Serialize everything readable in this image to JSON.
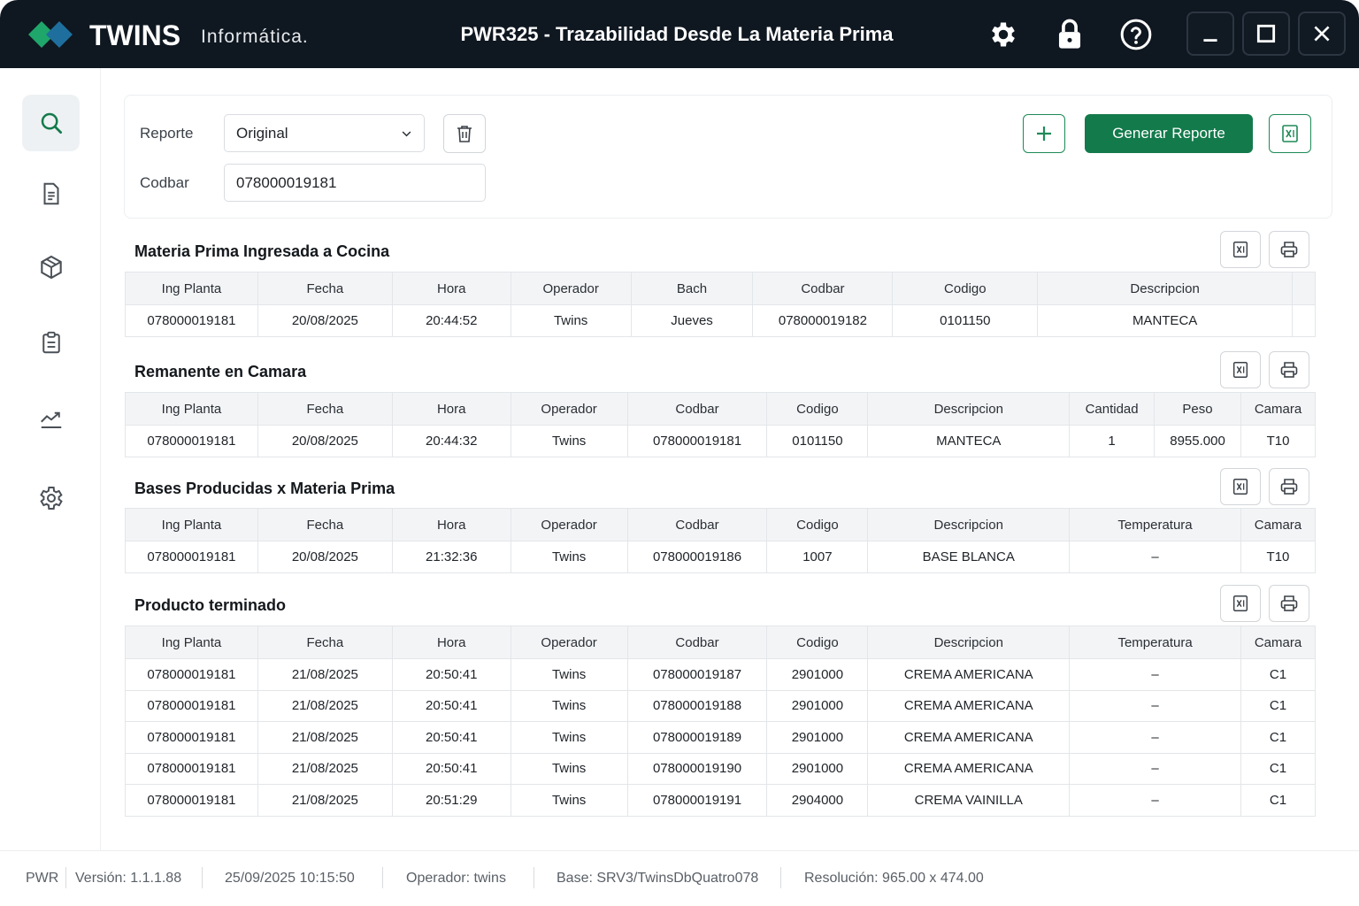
{
  "app": {
    "brand": "TWINS",
    "brand_sub": "Informática.",
    "window_title": "PWR325 - Trazabilidad Desde La Materia Prima"
  },
  "titlebar_icons": [
    "gear-icon",
    "lock-icon",
    "help-icon"
  ],
  "window_controls": [
    "minimize-icon",
    "maximize-icon",
    "close-icon"
  ],
  "sidebar": {
    "items": [
      {
        "icon": "search-icon",
        "active": true
      },
      {
        "icon": "document-icon",
        "active": false
      },
      {
        "icon": "box-icon",
        "active": false
      },
      {
        "icon": "clipboard-icon",
        "active": false
      },
      {
        "icon": "chart-line-icon",
        "active": false
      },
      {
        "icon": "settings-icon",
        "active": false
      }
    ]
  },
  "filters": {
    "reporte_label": "Reporte",
    "reporte_value": "Original",
    "codbar_label": "Codbar",
    "codbar_value": "078000019181",
    "generate_label": "Generar Reporte"
  },
  "colors": {
    "titlebar": "#0f1720",
    "accent_green": "#137a4b",
    "logo_green": "#1fa66a",
    "logo_blue": "#1f6f9e"
  },
  "sections": [
    {
      "title": "Materia Prima Ingresada a Cocina",
      "columns": [
        "Ing Planta",
        "Fecha",
        "Hora",
        "Operador",
        "Bach",
        "Codbar",
        "Codigo",
        "Descripcion",
        ""
      ],
      "rows": [
        [
          "078000019181",
          "20/08/2025",
          "20:44:52",
          "Twins",
          "Jueves",
          "078000019182",
          "0101150",
          "MANTECA",
          ""
        ]
      ]
    },
    {
      "title": "Remanente en Camara",
      "columns": [
        "Ing Planta",
        "Fecha",
        "Hora",
        "Operador",
        "Codbar",
        "Codigo",
        "Descripcion",
        "Cantidad",
        "Peso",
        "Camara"
      ],
      "rows": [
        [
          "078000019181",
          "20/08/2025",
          "20:44:32",
          "Twins",
          "078000019181",
          "0101150",
          "MANTECA",
          "1",
          "8955.000",
          "T10"
        ]
      ]
    },
    {
      "title": "Bases Producidas x Materia Prima",
      "columns": [
        "Ing Planta",
        "Fecha",
        "Hora",
        "Operador",
        "Codbar",
        "Codigo",
        "Descripcion",
        "Temperatura",
        "Camara"
      ],
      "rows": [
        [
          "078000019181",
          "20/08/2025",
          "21:32:36",
          "Twins",
          "078000019186",
          "1007",
          "BASE BLANCA",
          "–",
          "T10"
        ]
      ]
    },
    {
      "title": "Producto terminado",
      "columns": [
        "Ing Planta",
        "Fecha",
        "Hora",
        "Operador",
        "Codbar",
        "Codigo",
        "Descripcion",
        "Temperatura",
        "Camara"
      ],
      "rows": [
        [
          "078000019181",
          "21/08/2025",
          "20:50:41",
          "Twins",
          "078000019187",
          "2901000",
          "CREMA AMERICANA",
          "–",
          "C1"
        ],
        [
          "078000019181",
          "21/08/2025",
          "20:50:41",
          "Twins",
          "078000019188",
          "2901000",
          "CREMA AMERICANA",
          "–",
          "C1"
        ],
        [
          "078000019181",
          "21/08/2025",
          "20:50:41",
          "Twins",
          "078000019189",
          "2901000",
          "CREMA AMERICANA",
          "–",
          "C1"
        ],
        [
          "078000019181",
          "21/08/2025",
          "20:50:41",
          "Twins",
          "078000019190",
          "2901000",
          "CREMA AMERICANA",
          "–",
          "C1"
        ],
        [
          "078000019181",
          "21/08/2025",
          "20:51:29",
          "Twins",
          "078000019191",
          "2904000",
          "CREMA VAINILLA",
          "–",
          "C1"
        ]
      ]
    }
  ],
  "status": {
    "app": "PWR",
    "version": "Versión: 1.1.1.88",
    "datetime": "25/09/2025 10:15:50",
    "operator": "Operador: twins",
    "base": "Base: SRV3/TwinsDbQuatro078",
    "resolution": "Resolución: 965.00 x 474.00"
  }
}
